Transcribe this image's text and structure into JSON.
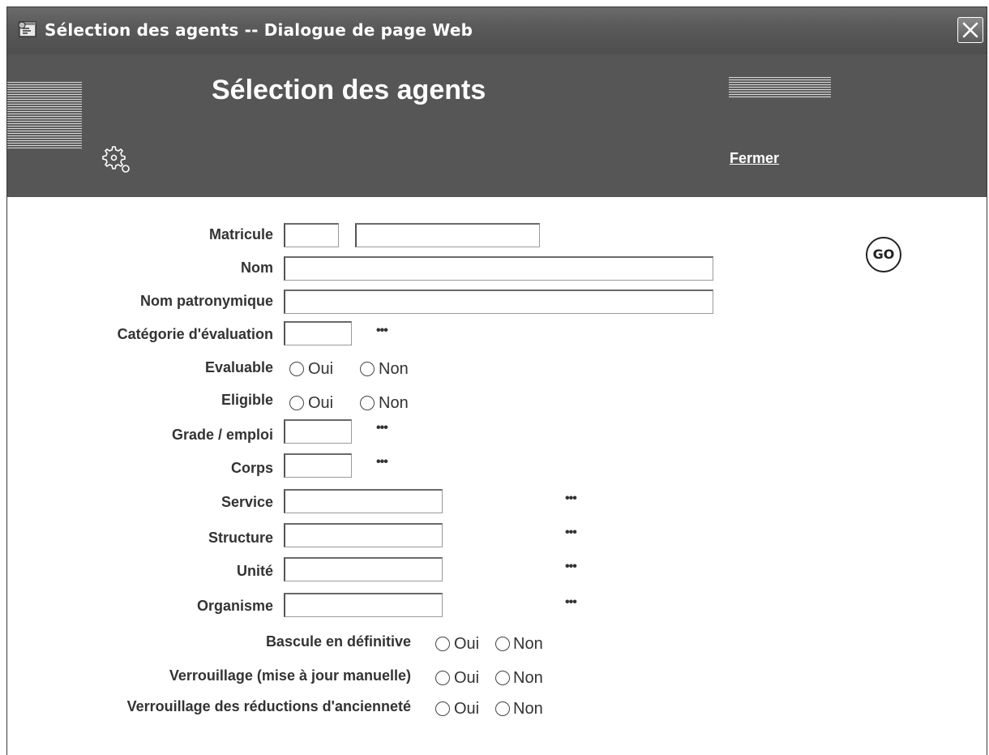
{
  "window": {
    "title": "Sélection des agents -- Dialogue de page Web"
  },
  "header": {
    "title": "Sélection des agents",
    "close_link": "Fermer"
  },
  "form": {
    "matricule": {
      "label": "Matricule",
      "value1": "",
      "value2": ""
    },
    "nom": {
      "label": "Nom",
      "value": ""
    },
    "nom_patronymique": {
      "label": "Nom patronymique",
      "value": ""
    },
    "categorie": {
      "label": "Catégorie d'évaluation",
      "value": "",
      "lookup": "•••"
    },
    "evaluable": {
      "label": "Evaluable",
      "oui": "Oui",
      "non": "Non",
      "selected": null
    },
    "eligible": {
      "label": "Eligible",
      "oui": "Oui",
      "non": "Non",
      "selected": null
    },
    "grade": {
      "label": "Grade / emploi",
      "value": "",
      "lookup": "•••"
    },
    "corps": {
      "label": "Corps",
      "value": "",
      "lookup": "•••"
    },
    "service": {
      "label": "Service",
      "value": "",
      "lookup": "•••"
    },
    "structure": {
      "label": "Structure",
      "value": "",
      "lookup": "•••"
    },
    "unite": {
      "label": "Unité",
      "value": "",
      "lookup": "•••"
    },
    "organisme": {
      "label": "Organisme",
      "value": "",
      "lookup": "•••"
    },
    "bascule": {
      "label": "Bascule en définitive",
      "oui": "Oui",
      "non": "Non",
      "selected": null
    },
    "verrouillage_maj": {
      "label": "Verrouillage (mise à jour manuelle)",
      "oui": "Oui",
      "non": "Non",
      "selected": null
    },
    "verrouillage_reductions": {
      "label": "Verrouillage des réductions d'ancienneté",
      "oui": "Oui",
      "non": "Non",
      "selected": null
    },
    "go_label": "GO"
  },
  "icons": {
    "app": "dialog-page-icon",
    "close": "close-icon",
    "settings": "gear-icon"
  }
}
